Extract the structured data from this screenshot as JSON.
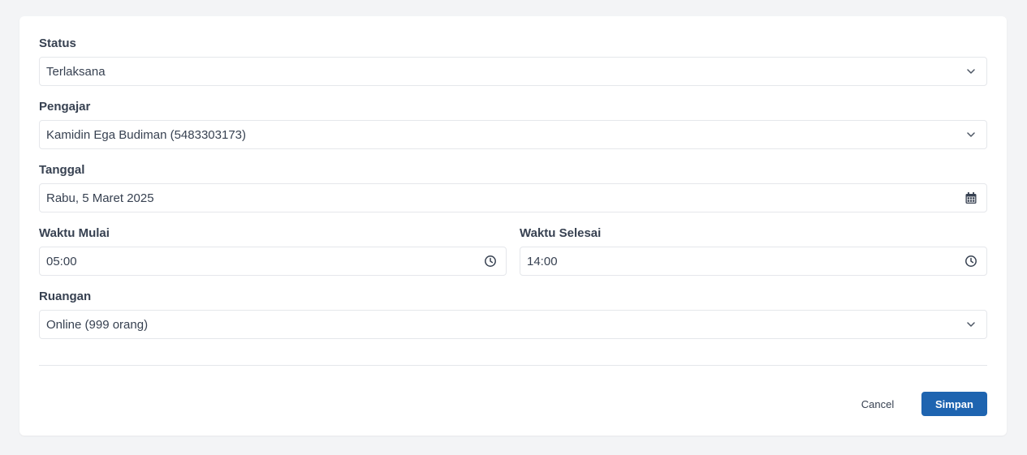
{
  "form": {
    "status": {
      "label": "Status",
      "value": "Terlaksana",
      "icon": "chevron-down-icon"
    },
    "pengajar": {
      "label": "Pengajar",
      "value": "Kamidin Ega Budiman (5483303173)",
      "icon": "chevron-down-icon"
    },
    "tanggal": {
      "label": "Tanggal",
      "value": "Rabu, 5 Maret 2025",
      "icon": "calendar-icon"
    },
    "waktu_mulai": {
      "label": "Waktu Mulai",
      "value": "05:00",
      "icon": "clock-icon"
    },
    "waktu_selesai": {
      "label": "Waktu Selesai",
      "value": "14:00",
      "icon": "clock-icon"
    },
    "ruangan": {
      "label": "Ruangan",
      "value": "Online (999 orang)",
      "icon": "chevron-down-icon"
    }
  },
  "actions": {
    "cancel_label": "Cancel",
    "save_label": "Simpan"
  },
  "colors": {
    "primary": "#1e64b0",
    "page_background": "#f3f4f6",
    "border": "#e5e7eb"
  }
}
